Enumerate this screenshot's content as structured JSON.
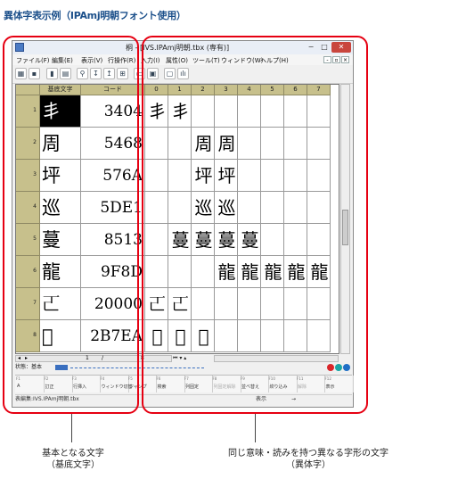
{
  "page_title": "異体字表示例（IPAmj明朝フォント使用）",
  "window": {
    "title": "桐 - [IVS.IPAmj明朝.tbx (専有)]",
    "buttons": {
      "minimize": "−",
      "maximize": "□",
      "close": "✕"
    }
  },
  "menu": [
    "ファイル(F)",
    "編集(E)",
    "表示(V)",
    "行操作(R)",
    "入力(I)",
    "属性(O)",
    "ツール(T)",
    "ウィンドウ(W)",
    "ヘルプ(H)"
  ],
  "mdi_buttons": [
    "-",
    "▫",
    "×"
  ],
  "grid": {
    "headers": {
      "base": "基底文字",
      "code": "コード",
      "variants": [
        "0",
        "1",
        "2",
        "3",
        "4",
        "5",
        "6",
        "7"
      ]
    },
    "rows": [
      {
        "num": "1",
        "base": "丯",
        "code": "3404",
        "v": [
          "丯",
          "丯",
          "",
          "",
          "",
          "",
          "",
          ""
        ]
      },
      {
        "num": "2",
        "base": "周",
        "code": "5468",
        "v": [
          "",
          "",
          "周",
          "周",
          "",
          "",
          "",
          ""
        ]
      },
      {
        "num": "3",
        "base": "坪",
        "code": "576A",
        "v": [
          "",
          "",
          "坪",
          "坪",
          "",
          "",
          "",
          ""
        ]
      },
      {
        "num": "4",
        "base": "巡",
        "code": "5DE1",
        "v": [
          "",
          "",
          "巡",
          "巡",
          "",
          "",
          "",
          ""
        ]
      },
      {
        "num": "5",
        "base": "蔓",
        "code": "8513",
        "v": [
          "",
          "蔓",
          "蔓",
          "蔓",
          "蔓",
          "",
          "",
          ""
        ]
      },
      {
        "num": "6",
        "base": "龍",
        "code": "9F8D",
        "v": [
          "",
          "",
          "",
          "龍",
          "龍",
          "龍",
          "龍",
          "龍"
        ]
      },
      {
        "num": "7",
        "base": "𠀀",
        "code": "20000",
        "v": [
          "𠀀",
          "𠀀",
          "",
          "",
          "",
          "",
          "",
          ""
        ]
      },
      {
        "num": "8",
        "base": "𫞪",
        "code": "2B7EA",
        "v": [
          "𫞪",
          "𫞪",
          "𫞪",
          "",
          "",
          "",
          "",
          ""
        ]
      }
    ]
  },
  "pager": {
    "current": "1",
    "sep": "/",
    "total": "8"
  },
  "status_text": "状態：基本",
  "fkeys": [
    {
      "n": "F1",
      "label": "A"
    },
    {
      "n": "F2",
      "label": "訂正"
    },
    {
      "n": "F3",
      "label": "行挿入"
    },
    {
      "n": "F4",
      "label": "ウィンドウ切替"
    },
    {
      "n": "F5",
      "label": "ジャンプ"
    },
    {
      "n": "F6",
      "label": "検索"
    },
    {
      "n": "F7",
      "label": "列固定"
    },
    {
      "n": "F8",
      "label": "列固定解除"
    },
    {
      "n": "F9",
      "label": "並べ替え"
    },
    {
      "n": "F10",
      "label": "絞り込み"
    },
    {
      "n": "F11",
      "label": "解除"
    },
    {
      "n": "F12",
      "label": "表示"
    }
  ],
  "file_status": {
    "name": "表編集:IVS.IPAmj明朝.tbx",
    "mode": "表示",
    "arrow": "→"
  },
  "annotations": {
    "left": {
      "line1": "基本となる文字",
      "line2": "（基底文字）"
    },
    "right": {
      "line1": "同じ意味・読みを持つ異なる字形の文字",
      "line2": "（異体字）"
    }
  },
  "colors": {
    "callout": "#e60012",
    "header_bg": "#c7c08c",
    "title": "#1b4f8a",
    "status_dots": [
      "#d9262a",
      "#1aa5a5",
      "#1f6fc6"
    ]
  }
}
